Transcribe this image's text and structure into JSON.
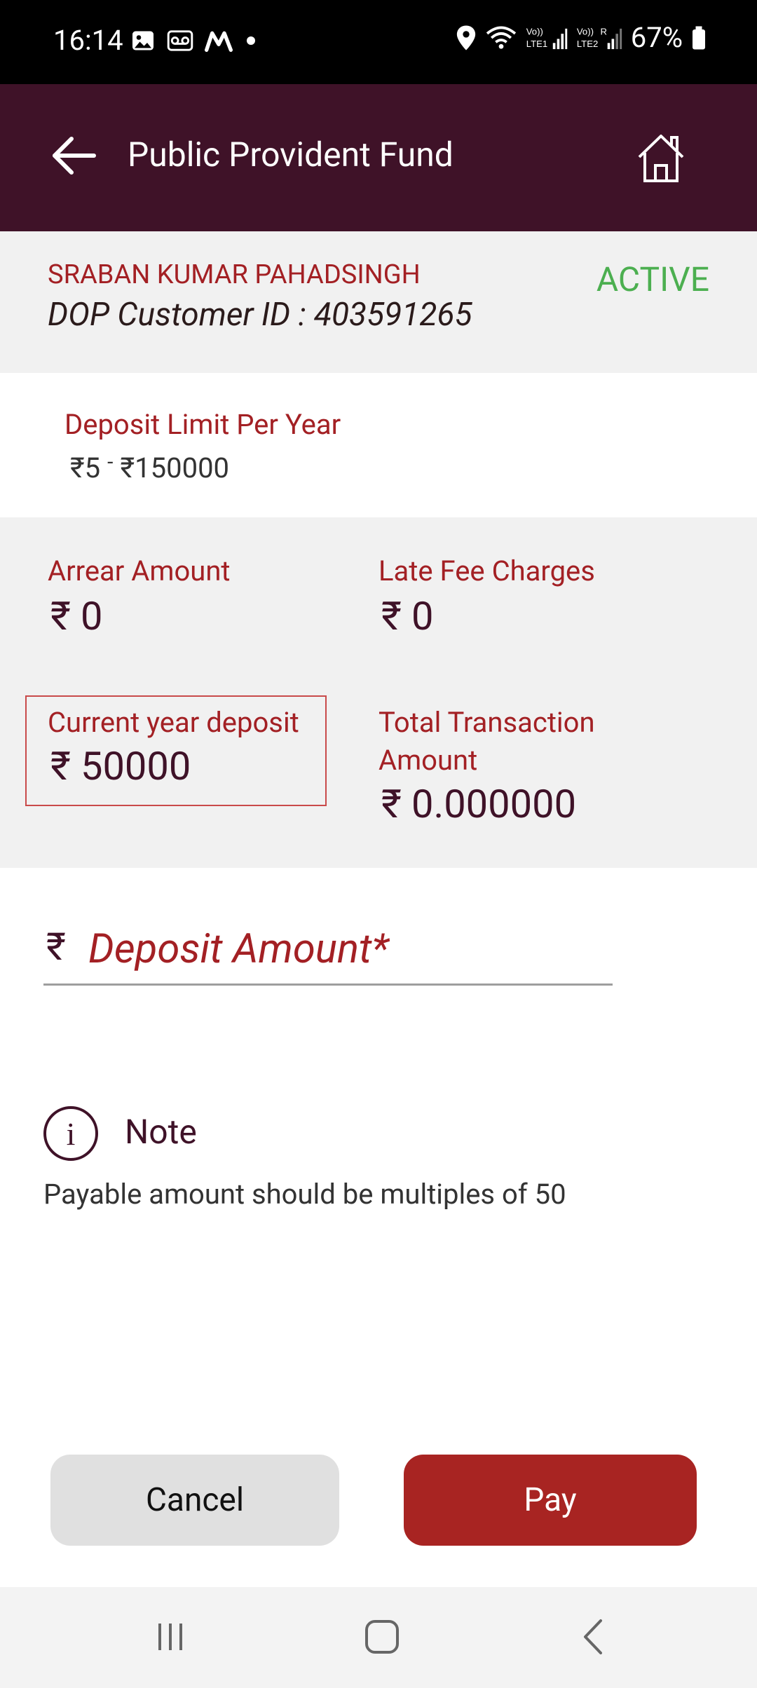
{
  "status_bar": {
    "time": "16:14",
    "battery": "67%",
    "left_icons": [
      "gallery-icon",
      "voicemail-icon",
      "m-app-icon",
      "dot-icon"
    ],
    "right_icons": [
      "location-icon",
      "wifi-icon",
      "signal-lte1-icon",
      "signal-lte2-icon",
      "battery-icon"
    ],
    "lte1_label": "Vo)) LTE1",
    "lte2_label": "Vo)) LTE2"
  },
  "header": {
    "title": "Public Provident Fund",
    "back_icon": "arrow-left-icon",
    "home_icon": "home-icon",
    "background": "#3F1228"
  },
  "customer": {
    "name": "SRABAN KUMAR PAHADSINGH",
    "id_line": "DOP Customer ID : 403591265",
    "status": "ACTIVE",
    "status_color": "#4CAF50"
  },
  "limit": {
    "label": "Deposit Limit Per Year",
    "min": "₹5",
    "separator": "-",
    "max": "₹150000"
  },
  "amounts": {
    "arrear_label": "Arrear Amount",
    "arrear_value": "0",
    "late_fee_label": "Late Fee Charges",
    "late_fee_value": "0",
    "current_year_label": "Current year deposit",
    "current_year_value": "50000",
    "total_txn_label_line1": "Total Transaction",
    "total_txn_label_line2": "Amount",
    "total_txn_value": "0.000000",
    "currency": "₹"
  },
  "deposit_input": {
    "currency": "₹",
    "placeholder": "Deposit Amount*",
    "value": ""
  },
  "note": {
    "icon": "info-icon",
    "title": "Note",
    "text": "Payable amount should be multiples of 50"
  },
  "actions": {
    "cancel_label": "Cancel",
    "pay_label": "Pay",
    "accent": "#A82422"
  },
  "nav_bar": {
    "icons": [
      "recent-apps-icon",
      "home-nav-icon",
      "back-nav-icon"
    ]
  }
}
